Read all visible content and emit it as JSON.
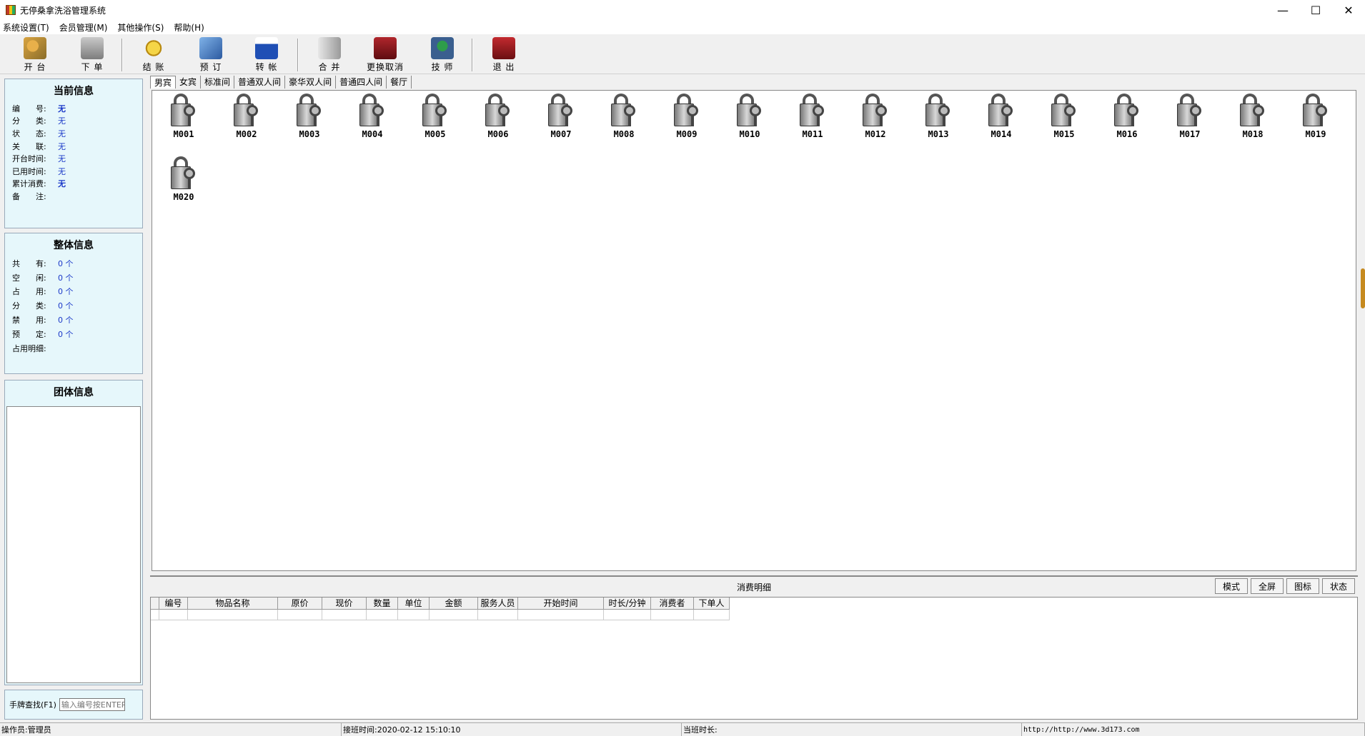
{
  "window": {
    "title": "无停桑拿洗浴管理系统",
    "minimize": "—",
    "maximize": "☐",
    "close": "✕"
  },
  "menu": [
    "系统设置(T)",
    "会员管理(M)",
    "其他操作(S)",
    "帮助(H)"
  ],
  "toolbar": [
    {
      "label": "开 台",
      "icon": "key-icon"
    },
    {
      "label": "下 单",
      "icon": "order-icon"
    },
    {
      "label": "结 账",
      "icon": "pay-icon"
    },
    {
      "label": "预 订",
      "icon": "book-icon"
    },
    {
      "label": "转 帐",
      "icon": "transfer-icon"
    },
    {
      "label": "合 并",
      "icon": "merge-icon"
    },
    {
      "label": "更换取消",
      "icon": "swap-icon"
    },
    {
      "label": "技 师",
      "icon": "tech-icon"
    },
    {
      "label": "退 出",
      "icon": "exit-icon"
    }
  ],
  "current_info": {
    "title": "当前信息",
    "rows": [
      {
        "key": "编　　号:",
        "value": "无"
      },
      {
        "key": "分　　类:",
        "value": "无"
      },
      {
        "key": "状　　态:",
        "value": "无"
      },
      {
        "key": "关　　联:",
        "value": "无"
      },
      {
        "key": "开台时间:",
        "value": "无"
      },
      {
        "key": "已用时间:",
        "value": "无"
      },
      {
        "key": "累计消费:",
        "value": "无"
      },
      {
        "key": "备　　注:",
        "value": ""
      }
    ]
  },
  "overall_info": {
    "title": "整体信息",
    "rows": [
      {
        "key": "共　　有:",
        "value": "0 个"
      },
      {
        "key": "空　　闲:",
        "value": "0 个"
      },
      {
        "key": "占　　用:",
        "value": "0 个"
      },
      {
        "key": "分　　类:",
        "value": "0 个"
      },
      {
        "key": "禁　　用:",
        "value": "0 个"
      },
      {
        "key": "预　　定:",
        "value": "0 个"
      },
      {
        "key": "占用明细:",
        "value": ""
      }
    ]
  },
  "group_info": {
    "title": "团体信息"
  },
  "search": {
    "label": "手牌查找(F1)",
    "placeholder": "输入编号按ENTER"
  },
  "tabs": [
    "男宾",
    "女宾",
    "标准间",
    "普通双人间",
    "豪华双人间",
    "普通四人间",
    "餐厅"
  ],
  "rooms": [
    "M001",
    "M002",
    "M003",
    "M004",
    "M005",
    "M006",
    "M007",
    "M008",
    "M009",
    "M010",
    "M011",
    "M012",
    "M013",
    "M014",
    "M015",
    "M016",
    "M017",
    "M018",
    "M019",
    "M020"
  ],
  "details": {
    "title": "消费明细",
    "buttons": [
      "模式",
      "全屏",
      "图标",
      "状态"
    ],
    "columns": [
      "编号",
      "物品名称",
      "原价",
      "现价",
      "数量",
      "单位",
      "金额",
      "服务人员",
      "开始时间",
      "时长/分钟",
      "消费者",
      "下单人"
    ]
  },
  "status": {
    "operator": "操作员:管理员",
    "shift_time": "接班时间:2020-02-12 15:10:10",
    "shift_leader": "当班时长:",
    "url": "http://http://www.3d173.com"
  }
}
